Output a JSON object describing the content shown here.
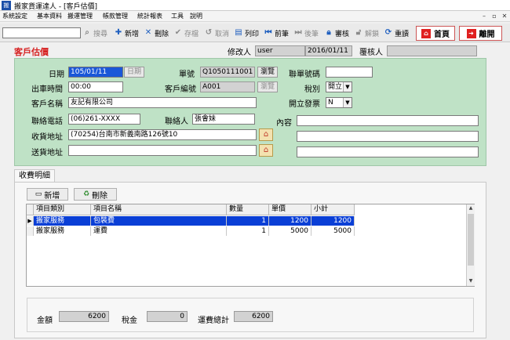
{
  "window": {
    "title": "搬家貨運達人 - [客戶估價]"
  },
  "menu": [
    "系統設定",
    "基本資料",
    "搬運管理",
    "帳款管理",
    "統計報表",
    "工具",
    "說明"
  ],
  "toolbar": {
    "search_value": "",
    "search": "搜尋",
    "add": "新增",
    "delete": "刪除",
    "save": "存檔",
    "cancel": "取消",
    "print": "列印",
    "prev": "前筆",
    "next": "後筆",
    "review": "審核",
    "unreview": "解鎖",
    "refresh": "重讀",
    "home": "首頁",
    "exit": "離開"
  },
  "page": {
    "title": "客戶估價",
    "modifier_label": "修改人",
    "modifier": "user",
    "modified_date": "2016/01/11",
    "reviewer_label": "覆核人",
    "reviewer": ""
  },
  "form": {
    "date_label": "日期",
    "date": "105/01/11",
    "date_btn": "日期",
    "order_label": "單號",
    "order_no": "Q1050111001",
    "browse": "瀏覽",
    "contact_no_label": "聯單號碼",
    "contact_no": "",
    "time_label": "出車時間",
    "time": "00:00",
    "cust_code_label": "客戶編號",
    "cust_code": "A001",
    "tax_label": "稅別",
    "tax": "開立",
    "cust_name_label": "客戶名稱",
    "cust_name": "友記有限公司",
    "invoice_label": "開立發票",
    "invoice": "N",
    "phone_label": "聯絡電話",
    "phone": "(06)261-XXXX",
    "contact_label": "聯絡人",
    "contact": "張會妹",
    "content_label": "內容",
    "content": "",
    "pickup_label": "收貨地址",
    "pickup": "(70254)台南市新義南路126號10",
    "delivery_label": "送貨地址",
    "delivery": ""
  },
  "details": {
    "tab": "收費明細",
    "add": "新增",
    "delete": "刪除",
    "columns": [
      "項目類別",
      "項目名稱",
      "數量",
      "單價",
      "小計"
    ],
    "rows": [
      {
        "category": "搬家服務",
        "name": "包裝費",
        "qty": "1",
        "price": "1200",
        "subtotal": "1200"
      },
      {
        "category": "搬家服務",
        "name": "運費",
        "qty": "1",
        "price": "5000",
        "subtotal": "5000"
      }
    ]
  },
  "totals": {
    "amount_label": "金額",
    "amount": "6200",
    "tax_label": "稅金",
    "tax": "0",
    "grand_label": "運費總計",
    "grand": "6200"
  },
  "colors": {
    "accent_red": "#e02020",
    "form_bg": "#bfe2c6",
    "selected_row": "#0a3fd6"
  }
}
